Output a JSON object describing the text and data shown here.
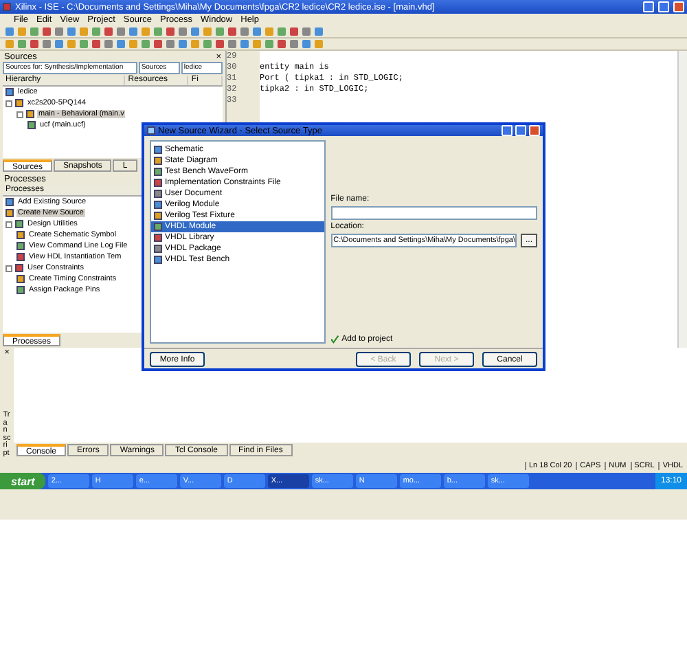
{
  "window": {
    "title": "Xilinx - ISE - C:\\Documents and Settings\\Miha\\My Documents\\fpga\\CR2 ledice\\CR2 ledice.ise - [main.vhd]"
  },
  "menu": [
    "File",
    "Edit",
    "View",
    "Project",
    "Source",
    "Process",
    "Window",
    "Help"
  ],
  "sources": {
    "title": "Sources",
    "close": "×",
    "dropdowns": [
      {
        "value": "Sources for: Synthesis/Implementation"
      },
      {
        "value": "Sources"
      },
      {
        "value": "ledice"
      }
    ],
    "columns": [
      "Hierarchy",
      "Resources",
      "Fi"
    ],
    "tree": [
      {
        "label": "ledice"
      },
      {
        "label": "xc2s200-5PQ144",
        "expanded": true,
        "children": [
          {
            "label": "main - Behavioral (main.v",
            "expanded": true,
            "selected": true,
            "children": [
              {
                "label": "ucf (main.ucf)",
                "selected": false
              }
            ]
          }
        ]
      }
    ]
  },
  "source_tabs": [
    {
      "label": "Sources",
      "selected": true
    },
    {
      "label": "Snapshots",
      "selected": false
    },
    {
      "label": "L",
      "selected": false
    }
  ],
  "processes": {
    "title": "Processes",
    "header": "Processes",
    "items": [
      {
        "label": "Add Existing Source",
        "selected": false
      },
      {
        "label": "Create New Source",
        "selected": true
      },
      {
        "label": "Design Utilities",
        "selected": false,
        "expanded": true,
        "children": [
          {
            "label": "Create Schematic Symbol",
            "selected": false
          },
          {
            "label": "View Command Line Log File",
            "selected": false
          },
          {
            "label": "View HDL Instantiation Tem",
            "selected": false
          }
        ]
      },
      {
        "label": "User Constraints",
        "selected": false,
        "expanded": true,
        "children": [
          {
            "label": "Create Timing Constraints",
            "selected": false
          },
          {
            "label": "Assign Package Pins",
            "selected": false
          }
        ]
      }
    ]
  },
  "process_tab": {
    "label": "Processes",
    "selected": true
  },
  "editor": {
    "lines": [
      {
        "number": "29"
      },
      {
        "number": "30",
        "code": "entity main is"
      },
      {
        "number": "31",
        "code": "    Port ( tipka1 : in  STD_LOGIC;"
      },
      {
        "number": "32",
        "code": "           tipka2 : in  STD_LOGIC;"
      },
      {
        "number": "33"
      }
    ]
  },
  "dialog": {
    "title": "New Source Wizard - Select Source Type",
    "types": [
      {
        "label": "Schematic",
        "selected": false
      },
      {
        "label": "State Diagram",
        "selected": false
      },
      {
        "label": "Test Bench WaveForm",
        "selected": false
      },
      {
        "label": "Implementation Constraints File",
        "selected": false
      },
      {
        "label": "User Document",
        "selected": false
      },
      {
        "label": "Verilog Module",
        "selected": false
      },
      {
        "label": "Verilog Test Fixture",
        "selected": false
      },
      {
        "label": "VHDL Module",
        "selected": true
      },
      {
        "label": "VHDL Library",
        "selected": false
      },
      {
        "label": "VHDL Package",
        "selected": false
      },
      {
        "label": "VHDL Test Bench",
        "selected": false
      }
    ],
    "file_name_label": "File name:",
    "location_label": "Location:",
    "location_value": "C:\\Documents and Settings\\Miha\\My Documents\\fpga\\",
    "browse": "...",
    "add_to_project": {
      "label": "Add to project",
      "checked": true
    },
    "buttons": [
      {
        "label": "More Info",
        "disabled": false
      },
      {
        "label": "< Back",
        "disabled": true
      },
      {
        "label": "Next >",
        "disabled": true
      },
      {
        "label": "Cancel",
        "disabled": false
      }
    ]
  },
  "transcript": {
    "title": "Transcript",
    "close": "×"
  },
  "console_tabs": [
    {
      "label": "Console",
      "selected": true
    },
    {
      "label": "Errors",
      "selected": false
    },
    {
      "label": "Warnings",
      "selected": false
    },
    {
      "label": "Tcl Console",
      "selected": false
    },
    {
      "label": "Find in Files",
      "selected": false
    }
  ],
  "status_bar": [
    "Ln 18 Col 20",
    "CAPS",
    "NUM",
    "SCRL",
    "VHDL"
  ],
  "taskbar": {
    "start": "start",
    "items": [
      {
        "label": "2...",
        "selected": false
      },
      {
        "label": "H",
        "selected": false
      },
      {
        "label": "e...",
        "selected": false
      },
      {
        "label": "V...",
        "selected": false
      },
      {
        "label": "D",
        "selected": false
      },
      {
        "label": "X...",
        "selected": true
      },
      {
        "label": "sk...",
        "selected": false
      },
      {
        "label": "N",
        "selected": false
      },
      {
        "label": "mo...",
        "selected": false
      },
      {
        "label": "b...",
        "selected": false
      },
      {
        "label": "sk...",
        "selected": false
      }
    ],
    "clock": "13:10"
  }
}
